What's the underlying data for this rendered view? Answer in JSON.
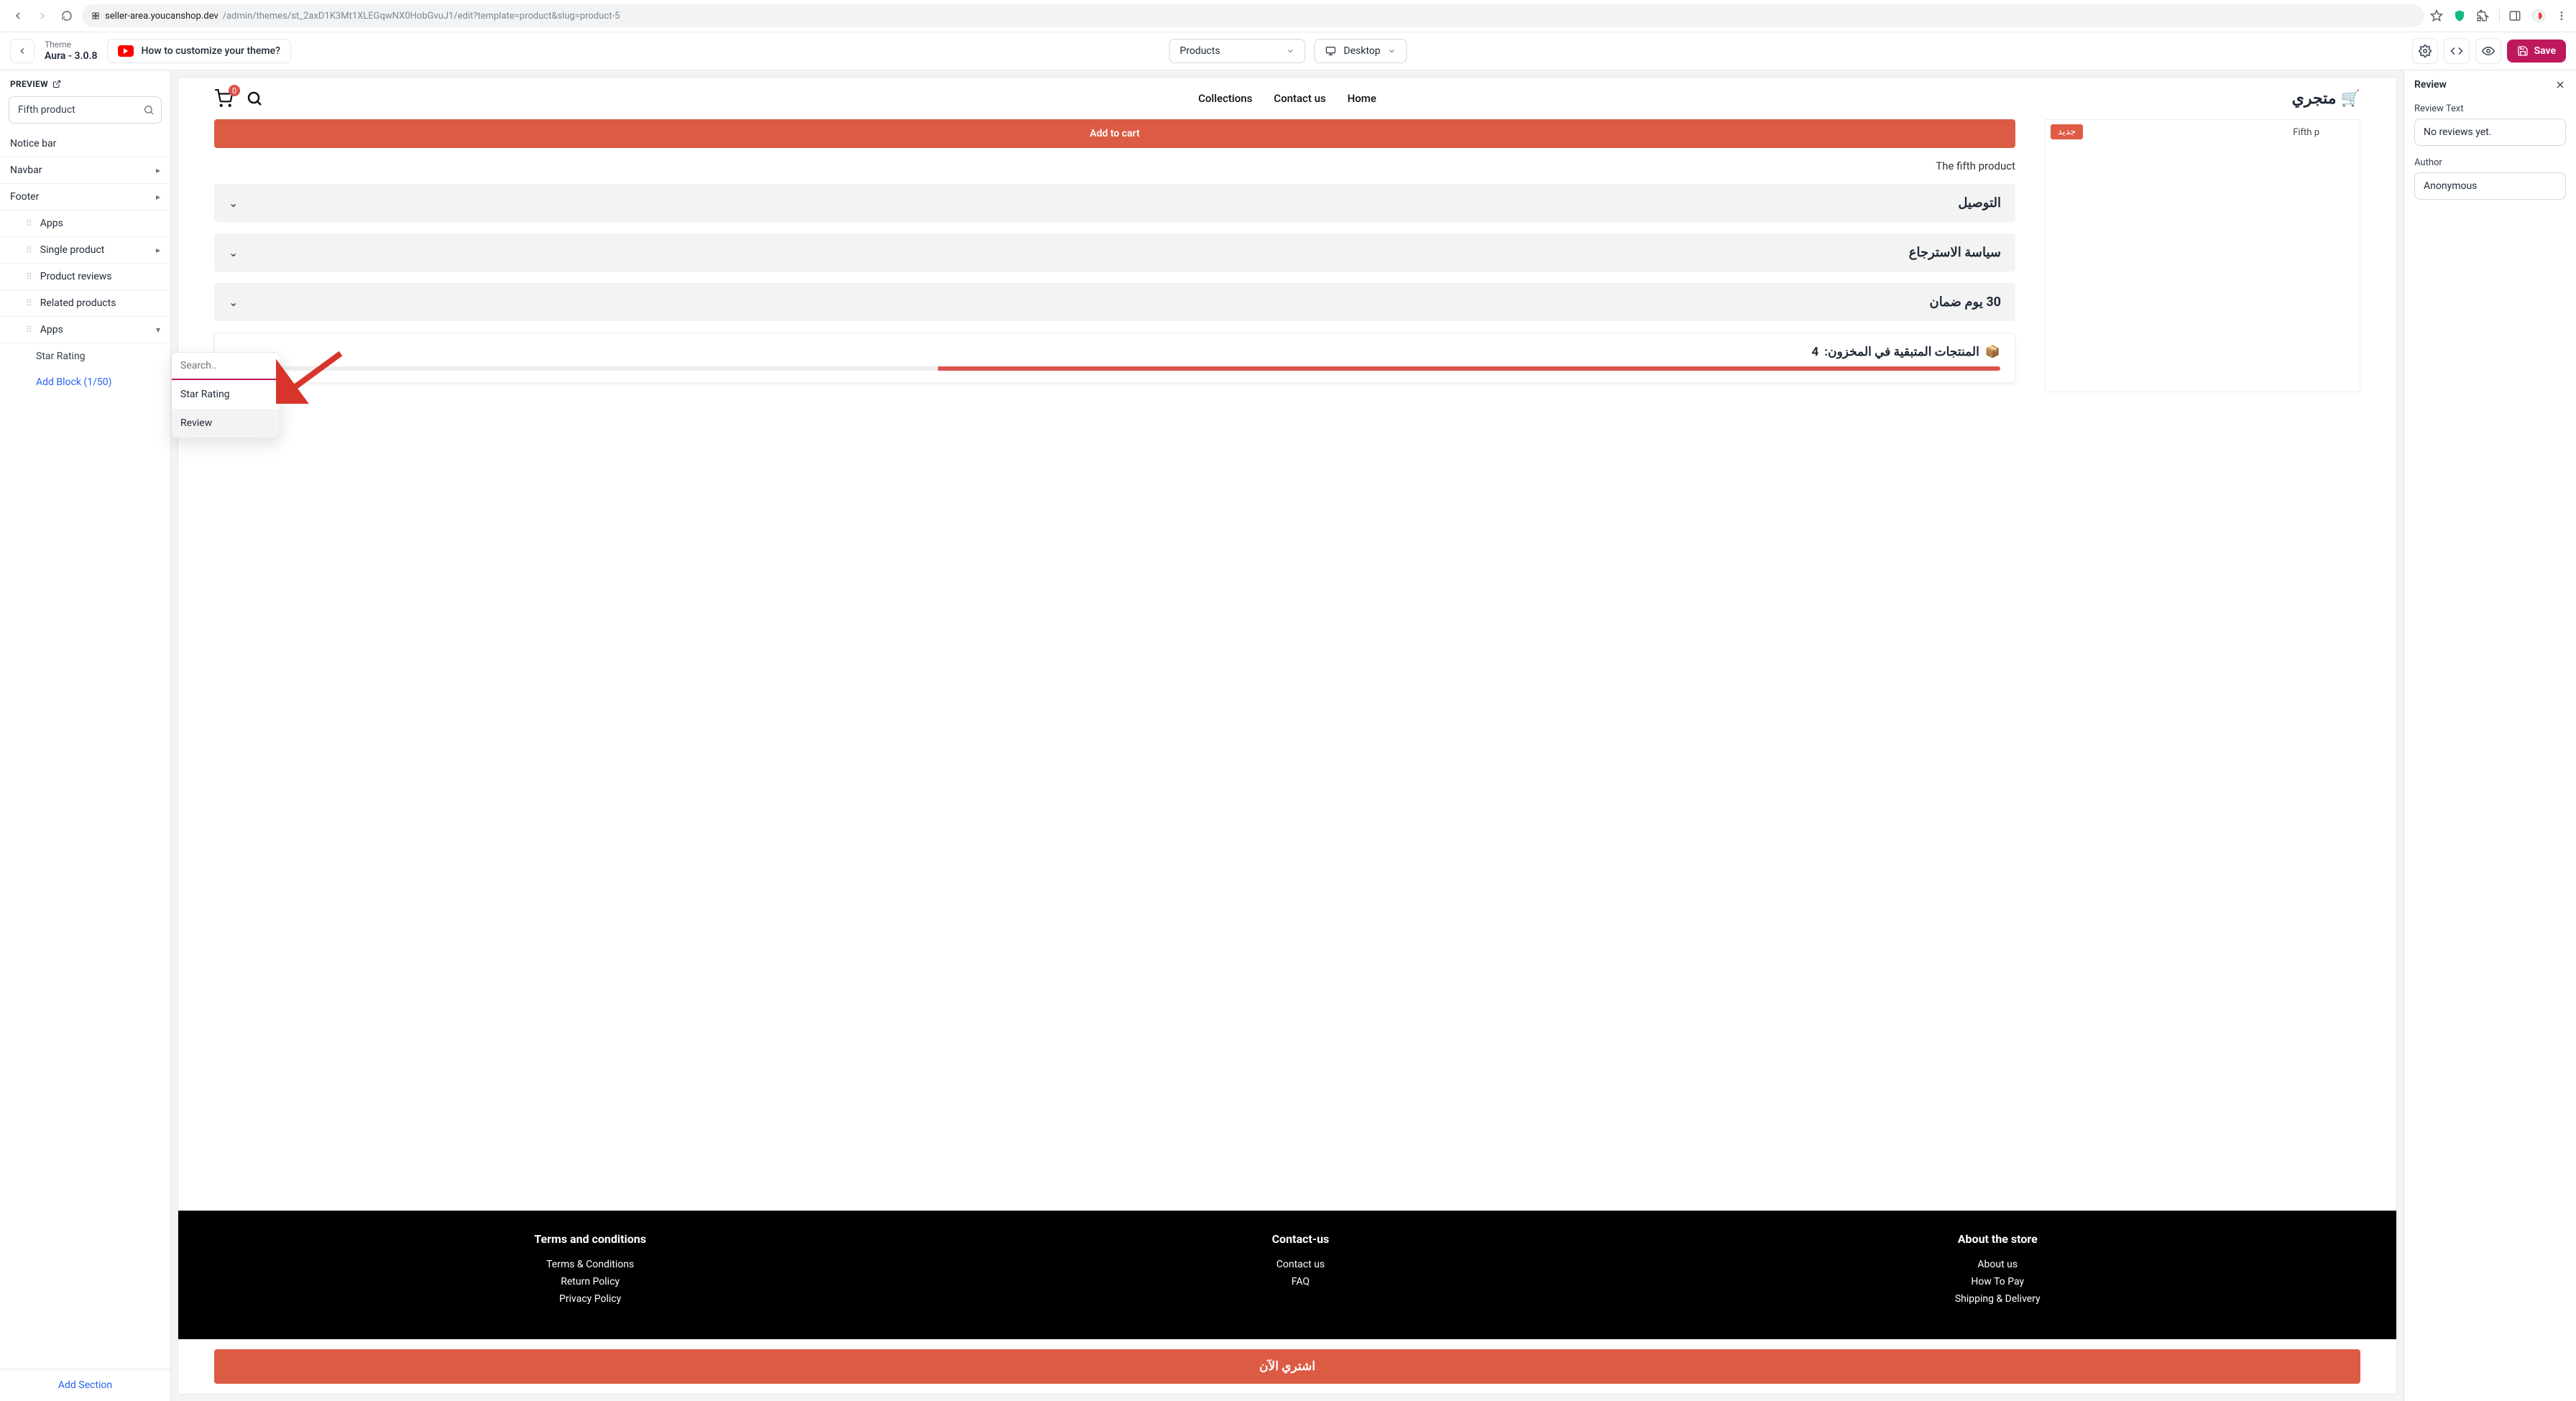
{
  "browser": {
    "url_host": "seller-area.youcanshop.dev",
    "url_path": "/admin/themes/st_2axD1K3Mt1XLEGqwNX0HobGvuJ1/edit?template=product&slug=product-5"
  },
  "appbar": {
    "theme_label": "Theme",
    "theme_name": "Aura - 3.0.8",
    "howto": "How to customize your theme?",
    "page_selector": "Products",
    "device": "Desktop",
    "save": "Save"
  },
  "sidebar": {
    "preview": "PREVIEW",
    "search_value": "Fifth product",
    "items": {
      "notice": "Notice bar",
      "navbar": "Navbar",
      "footer": "Footer",
      "apps1": "Apps",
      "single": "Single product",
      "reviews": "Product reviews",
      "related": "Related products",
      "apps2": "Apps",
      "star": "Star Rating",
      "add_block": "Add Block (1/50)"
    },
    "add_section": "Add Section"
  },
  "popup": {
    "search_placeholder": "Search..",
    "opt_star": "Star Rating",
    "opt_review": "Review"
  },
  "preview": {
    "cart_count": "0",
    "nav": {
      "collections": "Collections",
      "contact": "Contact us",
      "home": "Home"
    },
    "logo_text": "متجري",
    "product_badge": "جديد",
    "product_name_hint": "Fifth p",
    "add_to_cart": "Add to cart",
    "desc": "The fifth product",
    "acc1": "التوصيل",
    "acc2": "سياسة الاسترجاع",
    "acc3": "30 يوم ضمان",
    "stock_label": "المنتجات المتبقية في المخزون:",
    "stock_value": "4",
    "footer": {
      "col1_h": "Terms and conditions",
      "col1": [
        "Terms & Conditions",
        "Return Policy",
        "Privacy Policy"
      ],
      "col2_h": "Contact-us",
      "col2": [
        "Contact us",
        "FAQ"
      ],
      "col3_h": "About the store",
      "col3": [
        "About us",
        "How To Pay",
        "Shipping & Delivery"
      ]
    },
    "buy_now": "اشتري الآن"
  },
  "panel": {
    "title": "Review",
    "review_text_label": "Review Text",
    "review_text_value": "No reviews yet.",
    "author_label": "Author",
    "author_value": "Anonymous"
  }
}
